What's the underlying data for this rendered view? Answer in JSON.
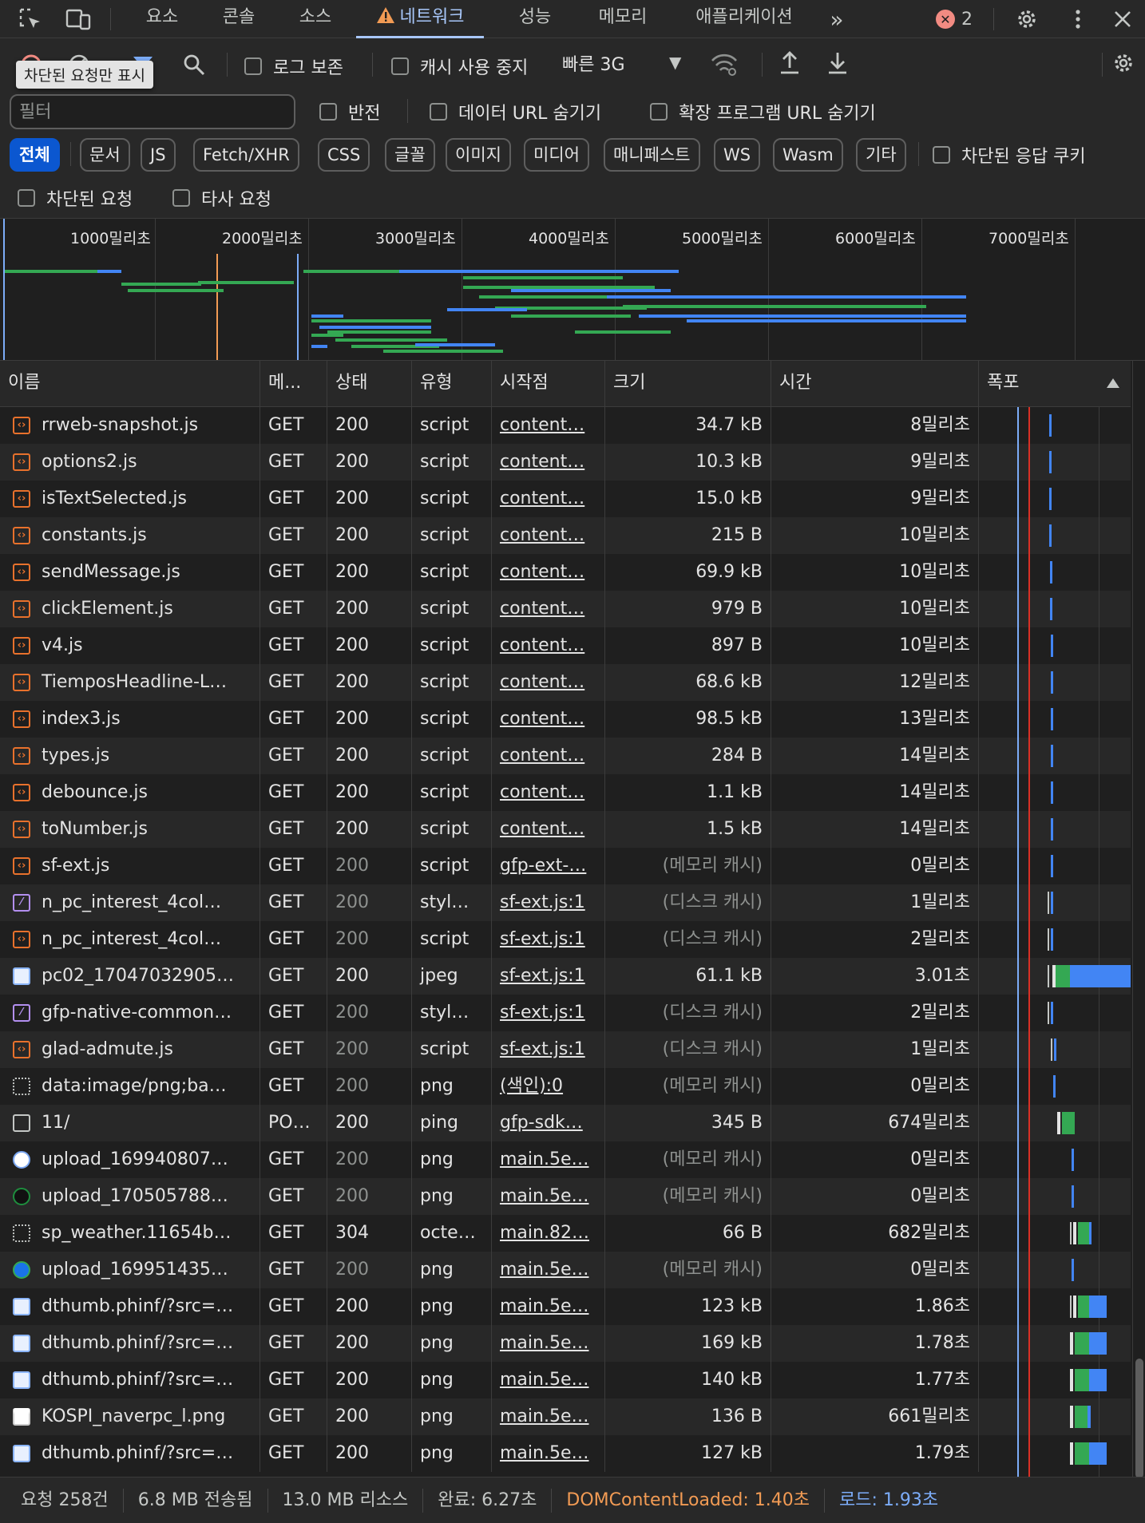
{
  "tabs": [
    {
      "label": "요소"
    },
    {
      "label": "콘솔"
    },
    {
      "label": "소스"
    },
    {
      "label": "네트워크",
      "active": true
    },
    {
      "label": "성능"
    },
    {
      "label": "메모리"
    },
    {
      "label": "애플리케이션"
    }
  ],
  "error_count": "2",
  "toolbar": {
    "preserve_log": "로그 보존",
    "disable_cache": "캐시 사용 중지",
    "throttling": "빠른 3G",
    "tooltip": "차단된 요청만 표시"
  },
  "filter": {
    "placeholder": "필터",
    "invert": "반전",
    "hide_data_urls": "데이터 URL 숨기기",
    "hide_extension_urls": "확장 프로그램 URL 숨기기",
    "types": [
      "전체",
      "문서",
      "JS",
      "Fetch/XHR",
      "CSS",
      "글꼴",
      "이미지",
      "미디어",
      "매니페스트",
      "WS",
      "Wasm",
      "기타"
    ],
    "blocked_response_cookies": "차단된 응답 쿠키",
    "blocked_requests": "차단된 요청",
    "third_party_requests": "타사 요청"
  },
  "overview": {
    "tick_labels": [
      "1000밀리초",
      "2000밀리초",
      "3000밀리초",
      "4000밀리초",
      "5000밀리초",
      "6000밀리초",
      "7000밀리초"
    ],
    "colors": {
      "dom_content_loaded": "#f29b54",
      "load": "#7cacf8",
      "waiting": "#34a853",
      "download": "#4285f4"
    }
  },
  "columns": [
    "이름",
    "메...",
    "상태",
    "유형",
    "시작점",
    "크기",
    "시간",
    "폭포"
  ],
  "rows": [
    {
      "icon": "script",
      "name": "rrweb-snapshot.js",
      "method": "GET",
      "status": "200",
      "type": "script",
      "initiator": "content…",
      "size": "34.7 kB",
      "time": "8밀리초",
      "status_dim": false,
      "size_dim": false
    },
    {
      "icon": "script",
      "name": "options2.js",
      "method": "GET",
      "status": "200",
      "type": "script",
      "initiator": "content…",
      "size": "10.3 kB",
      "time": "9밀리초",
      "status_dim": false,
      "size_dim": false
    },
    {
      "icon": "script",
      "name": "isTextSelected.js",
      "method": "GET",
      "status": "200",
      "type": "script",
      "initiator": "content…",
      "size": "15.0 kB",
      "time": "9밀리초",
      "status_dim": false,
      "size_dim": false
    },
    {
      "icon": "script",
      "name": "constants.js",
      "method": "GET",
      "status": "200",
      "type": "script",
      "initiator": "content…",
      "size": "215 B",
      "time": "10밀리초",
      "status_dim": false,
      "size_dim": false
    },
    {
      "icon": "script",
      "name": "sendMessage.js",
      "method": "GET",
      "status": "200",
      "type": "script",
      "initiator": "content…",
      "size": "69.9 kB",
      "time": "10밀리초",
      "status_dim": false,
      "size_dim": false
    },
    {
      "icon": "script",
      "name": "clickElement.js",
      "method": "GET",
      "status": "200",
      "type": "script",
      "initiator": "content…",
      "size": "979 B",
      "time": "10밀리초",
      "status_dim": false,
      "size_dim": false
    },
    {
      "icon": "script",
      "name": "v4.js",
      "method": "GET",
      "status": "200",
      "type": "script",
      "initiator": "content…",
      "size": "897 B",
      "time": "10밀리초",
      "status_dim": false,
      "size_dim": false
    },
    {
      "icon": "script",
      "name": "TiemposHeadline-L…",
      "method": "GET",
      "status": "200",
      "type": "script",
      "initiator": "content…",
      "size": "68.6 kB",
      "time": "12밀리초",
      "status_dim": false,
      "size_dim": false
    },
    {
      "icon": "script",
      "name": "index3.js",
      "method": "GET",
      "status": "200",
      "type": "script",
      "initiator": "content…",
      "size": "98.5 kB",
      "time": "13밀리초",
      "status_dim": false,
      "size_dim": false
    },
    {
      "icon": "script",
      "name": "types.js",
      "method": "GET",
      "status": "200",
      "type": "script",
      "initiator": "content…",
      "size": "284 B",
      "time": "14밀리초",
      "status_dim": false,
      "size_dim": false
    },
    {
      "icon": "script",
      "name": "debounce.js",
      "method": "GET",
      "status": "200",
      "type": "script",
      "initiator": "content…",
      "size": "1.1 kB",
      "time": "14밀리초",
      "status_dim": false,
      "size_dim": false
    },
    {
      "icon": "script",
      "name": "toNumber.js",
      "method": "GET",
      "status": "200",
      "type": "script",
      "initiator": "content…",
      "size": "1.5 kB",
      "time": "14밀리초",
      "status_dim": false,
      "size_dim": false
    },
    {
      "icon": "script",
      "name": "sf-ext.js",
      "method": "GET",
      "status": "200",
      "type": "script",
      "initiator": "gfp-ext-…",
      "size": "(메모리 캐시)",
      "time": "0밀리초",
      "status_dim": true,
      "size_dim": true
    },
    {
      "icon": "style",
      "name": "n_pc_interest_4col…",
      "method": "GET",
      "status": "200",
      "type": "styl…",
      "initiator": "sf-ext.js:1",
      "size": "(디스크 캐시)",
      "time": "1밀리초",
      "status_dim": true,
      "size_dim": true
    },
    {
      "icon": "script",
      "name": "n_pc_interest_4col…",
      "method": "GET",
      "status": "200",
      "type": "script",
      "initiator": "sf-ext.js:1",
      "size": "(디스크 캐시)",
      "time": "2밀리초",
      "status_dim": true,
      "size_dim": true
    },
    {
      "icon": "img",
      "name": "pc02_17047032905…",
      "method": "GET",
      "status": "200",
      "type": "jpeg",
      "initiator": "sf-ext.js:1",
      "size": "61.1 kB",
      "time": "3.01초",
      "status_dim": false,
      "size_dim": false
    },
    {
      "icon": "style",
      "name": "gfp-native-common…",
      "method": "GET",
      "status": "200",
      "type": "styl…",
      "initiator": "sf-ext.js:1",
      "size": "(디스크 캐시)",
      "time": "2밀리초",
      "status_dim": true,
      "size_dim": true
    },
    {
      "icon": "script",
      "name": "glad-admute.js",
      "method": "GET",
      "status": "200",
      "type": "script",
      "initiator": "sf-ext.js:1",
      "size": "(디스크 캐시)",
      "time": "1밀리초",
      "status_dim": true,
      "size_dim": true
    },
    {
      "icon": "data",
      "name": "data:image/png;ba…",
      "method": "GET",
      "status": "200",
      "type": "png",
      "initiator": "(색인):0",
      "size": "(메모리 캐시)",
      "time": "0밀리초",
      "status_dim": true,
      "size_dim": true
    },
    {
      "icon": "doc",
      "name": "11/",
      "method": "PO…",
      "status": "200",
      "type": "ping",
      "initiator": "gfp-sdk…",
      "size": "345 B",
      "time": "674밀리초",
      "status_dim": false,
      "size_dim": false
    },
    {
      "icon": "upa",
      "name": "upload_169940807…",
      "method": "GET",
      "status": "200",
      "type": "png",
      "initiator": "main.5e…",
      "size": "(메모리 캐시)",
      "time": "0밀리초",
      "status_dim": true,
      "size_dim": true
    },
    {
      "icon": "upb",
      "name": "upload_170505788…",
      "method": "GET",
      "status": "200",
      "type": "png",
      "initiator": "main.5e…",
      "size": "(메모리 캐시)",
      "time": "0밀리초",
      "status_dim": true,
      "size_dim": true
    },
    {
      "icon": "data",
      "name": "sp_weather.11654b…",
      "method": "GET",
      "status": "304",
      "type": "octe…",
      "initiator": "main.82…",
      "size": "66 B",
      "time": "682밀리초",
      "status_dim": false,
      "size_dim": false
    },
    {
      "icon": "upc",
      "name": "upload_169951435…",
      "method": "GET",
      "status": "200",
      "type": "png",
      "initiator": "main.5e…",
      "size": "(메모리 캐시)",
      "time": "0밀리초",
      "status_dim": true,
      "size_dim": true
    },
    {
      "icon": "img",
      "name": "dthumb.phinf/?src=…",
      "method": "GET",
      "status": "200",
      "type": "png",
      "initiator": "main.5e…",
      "size": "123 kB",
      "time": "1.86초",
      "status_dim": false,
      "size_dim": false
    },
    {
      "icon": "img",
      "name": "dthumb.phinf/?src=…",
      "method": "GET",
      "status": "200",
      "type": "png",
      "initiator": "main.5e…",
      "size": "169 kB",
      "time": "1.78초",
      "status_dim": false,
      "size_dim": false
    },
    {
      "icon": "img",
      "name": "dthumb.phinf/?src=…",
      "method": "GET",
      "status": "200",
      "type": "png",
      "initiator": "main.5e…",
      "size": "140 kB",
      "time": "1.77초",
      "status_dim": false,
      "size_dim": false
    },
    {
      "icon": "kospi",
      "name": "KOSPI_naverpc_l.png",
      "method": "GET",
      "status": "200",
      "type": "png",
      "initiator": "main.5e…",
      "size": "136 B",
      "time": "661밀리초",
      "status_dim": false,
      "size_dim": false
    },
    {
      "icon": "img",
      "name": "dthumb.phinf/?src=…",
      "method": "GET",
      "status": "200",
      "type": "png",
      "initiator": "main.5e…",
      "size": "127 kB",
      "time": "1.79초",
      "status_dim": false,
      "size_dim": false
    }
  ],
  "status": {
    "requests": "요청 258건",
    "transferred": "6.8 MB 전송됨",
    "resources": "13.0 MB 리소스",
    "finish": "완료: 6.27초",
    "dcl": "DOMContentLoaded: 1.40초",
    "load": "로드: 1.93초"
  }
}
